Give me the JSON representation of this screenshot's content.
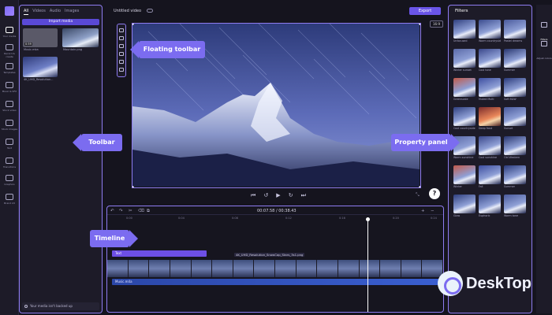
{
  "rail": {
    "items": [
      {
        "label": "Your media",
        "active": true
      },
      {
        "label": "Record & create"
      },
      {
        "label": "Templates"
      },
      {
        "label": "Music & SFX"
      },
      {
        "label": "Stock video"
      },
      {
        "label": "Stock images"
      },
      {
        "label": "Text"
      },
      {
        "label": "Transitions"
      },
      {
        "label": "Graphics"
      },
      {
        "label": "Brand kit"
      }
    ]
  },
  "media": {
    "tabs": [
      "All",
      "Videos",
      "Audio",
      "Images"
    ],
    "import_label": "Import media",
    "items": [
      {
        "name": "Music.mka",
        "duration": "0:59"
      },
      {
        "name": "Mountain.png"
      },
      {
        "name": "4K_UHD_Resolution..."
      }
    ],
    "footer": "Your media isn't backed up"
  },
  "editor": {
    "title": "Untitled video",
    "export_label": "Export",
    "aspect": "16:9"
  },
  "timeline": {
    "timecode": "00:07.58 / 00:38.43",
    "ticks": [
      "0:00",
      "0:04",
      "0:08",
      "0:12",
      "0:16",
      "0:20",
      "0:24"
    ],
    "text_clip": "Text",
    "video_file": "4K_UHD_Resolution_SnowCap_Stars_3s1.png",
    "audio_clip": "Music.m4a"
  },
  "properties": {
    "title": "Filters",
    "filters": [
      "Unfocused",
      "Warm countryside",
      "Pastel dreams",
      "Winter sunset",
      "Cool tone",
      "Summer",
      "Greenscale",
      "Muted Multi",
      "Soft B&W",
      "Cool countryside",
      "Deep frost",
      "Sunset",
      "Warm sunshine",
      "Cool sunshine",
      "Old Western",
      "Winter",
      "Fall",
      "Summer",
      "Glow",
      "Euphoric",
      "Warm tone"
    ]
  },
  "side_rail": {
    "items": [
      {
        "label": "Filters",
        "active": true
      },
      {
        "label": "Adjust colors"
      }
    ]
  },
  "callouts": {
    "floating_toolbar": "Floating toolbar",
    "toolbar": "Toolbar",
    "property_panel": "Property panel",
    "timeline": "Timeline"
  },
  "watermark": {
    "text": "DeskTop"
  }
}
